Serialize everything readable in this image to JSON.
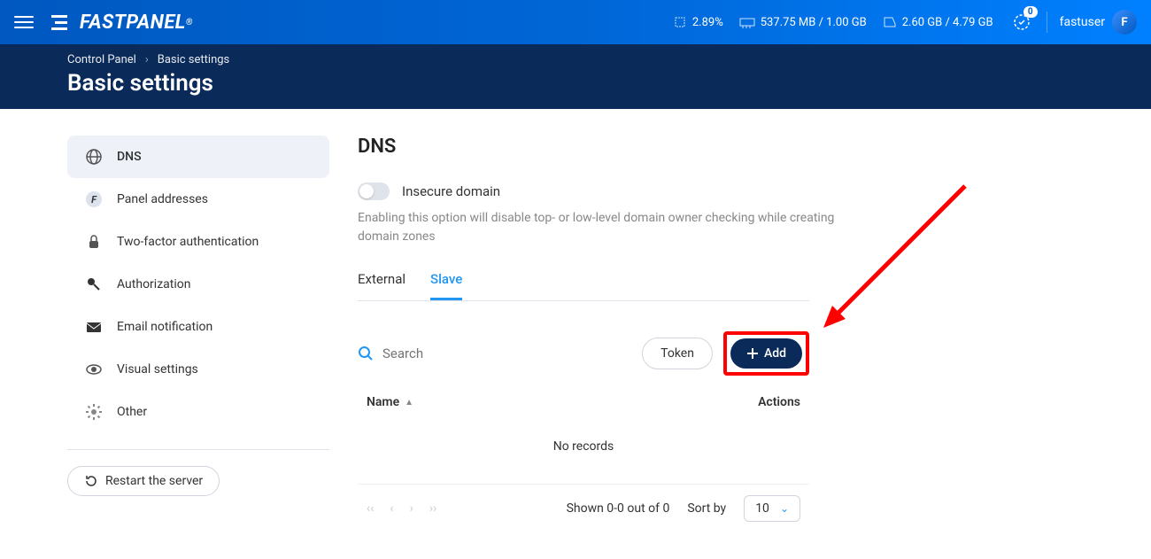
{
  "topbar": {
    "brand": "FASTPANEL",
    "cpu": "2.89%",
    "ram": "537.75 MB / 1.00 GB",
    "disk": "2.60 GB / 4.79 GB",
    "notif_count": "0",
    "username": "fastuser",
    "avatar_initial": "F"
  },
  "breadcrumb": {
    "root": "Control Panel",
    "current": "Basic settings"
  },
  "page_title": "Basic settings",
  "sidebar": {
    "items": [
      {
        "label": "DNS"
      },
      {
        "label": "Panel addresses"
      },
      {
        "label": "Two-factor authentication"
      },
      {
        "label": "Authorization"
      },
      {
        "label": "Email notification"
      },
      {
        "label": "Visual settings"
      },
      {
        "label": "Other"
      }
    ],
    "restart": "Restart the server"
  },
  "main": {
    "title": "DNS",
    "toggle_label": "Insecure domain",
    "toggle_desc": "Enabling this option will disable top- or low-level domain owner checking while creating domain zones",
    "tabs": [
      {
        "label": "External"
      },
      {
        "label": "Slave"
      }
    ],
    "search_placeholder": "Search",
    "token_btn": "Token",
    "add_btn": "Add",
    "col_name": "Name",
    "col_actions": "Actions",
    "no_records": "No records",
    "shown": "Shown 0-0 out of 0",
    "sortby": "Sort by",
    "page_size": "10"
  }
}
